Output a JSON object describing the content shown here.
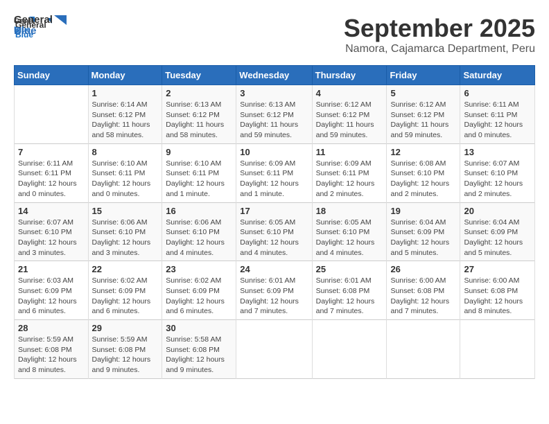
{
  "logo": {
    "general": "General",
    "blue": "Blue"
  },
  "title": "September 2025",
  "subtitle": "Namora, Cajamarca Department, Peru",
  "days_header": [
    "Sunday",
    "Monday",
    "Tuesday",
    "Wednesday",
    "Thursday",
    "Friday",
    "Saturday"
  ],
  "weeks": [
    [
      {
        "day": "",
        "info": ""
      },
      {
        "day": "1",
        "info": "Sunrise: 6:14 AM\nSunset: 6:12 PM\nDaylight: 11 hours\nand 58 minutes."
      },
      {
        "day": "2",
        "info": "Sunrise: 6:13 AM\nSunset: 6:12 PM\nDaylight: 11 hours\nand 58 minutes."
      },
      {
        "day": "3",
        "info": "Sunrise: 6:13 AM\nSunset: 6:12 PM\nDaylight: 11 hours\nand 59 minutes."
      },
      {
        "day": "4",
        "info": "Sunrise: 6:12 AM\nSunset: 6:12 PM\nDaylight: 11 hours\nand 59 minutes."
      },
      {
        "day": "5",
        "info": "Sunrise: 6:12 AM\nSunset: 6:12 PM\nDaylight: 11 hours\nand 59 minutes."
      },
      {
        "day": "6",
        "info": "Sunrise: 6:11 AM\nSunset: 6:11 PM\nDaylight: 12 hours\nand 0 minutes."
      }
    ],
    [
      {
        "day": "7",
        "info": "Sunrise: 6:11 AM\nSunset: 6:11 PM\nDaylight: 12 hours\nand 0 minutes."
      },
      {
        "day": "8",
        "info": "Sunrise: 6:10 AM\nSunset: 6:11 PM\nDaylight: 12 hours\nand 0 minutes."
      },
      {
        "day": "9",
        "info": "Sunrise: 6:10 AM\nSunset: 6:11 PM\nDaylight: 12 hours\nand 1 minute."
      },
      {
        "day": "10",
        "info": "Sunrise: 6:09 AM\nSunset: 6:11 PM\nDaylight: 12 hours\nand 1 minute."
      },
      {
        "day": "11",
        "info": "Sunrise: 6:09 AM\nSunset: 6:11 PM\nDaylight: 12 hours\nand 2 minutes."
      },
      {
        "day": "12",
        "info": "Sunrise: 6:08 AM\nSunset: 6:10 PM\nDaylight: 12 hours\nand 2 minutes."
      },
      {
        "day": "13",
        "info": "Sunrise: 6:07 AM\nSunset: 6:10 PM\nDaylight: 12 hours\nand 2 minutes."
      }
    ],
    [
      {
        "day": "14",
        "info": "Sunrise: 6:07 AM\nSunset: 6:10 PM\nDaylight: 12 hours\nand 3 minutes."
      },
      {
        "day": "15",
        "info": "Sunrise: 6:06 AM\nSunset: 6:10 PM\nDaylight: 12 hours\nand 3 minutes."
      },
      {
        "day": "16",
        "info": "Sunrise: 6:06 AM\nSunset: 6:10 PM\nDaylight: 12 hours\nand 4 minutes."
      },
      {
        "day": "17",
        "info": "Sunrise: 6:05 AM\nSunset: 6:10 PM\nDaylight: 12 hours\nand 4 minutes."
      },
      {
        "day": "18",
        "info": "Sunrise: 6:05 AM\nSunset: 6:10 PM\nDaylight: 12 hours\nand 4 minutes."
      },
      {
        "day": "19",
        "info": "Sunrise: 6:04 AM\nSunset: 6:09 PM\nDaylight: 12 hours\nand 5 minutes."
      },
      {
        "day": "20",
        "info": "Sunrise: 6:04 AM\nSunset: 6:09 PM\nDaylight: 12 hours\nand 5 minutes."
      }
    ],
    [
      {
        "day": "21",
        "info": "Sunrise: 6:03 AM\nSunset: 6:09 PM\nDaylight: 12 hours\nand 6 minutes."
      },
      {
        "day": "22",
        "info": "Sunrise: 6:02 AM\nSunset: 6:09 PM\nDaylight: 12 hours\nand 6 minutes."
      },
      {
        "day": "23",
        "info": "Sunrise: 6:02 AM\nSunset: 6:09 PM\nDaylight: 12 hours\nand 6 minutes."
      },
      {
        "day": "24",
        "info": "Sunrise: 6:01 AM\nSunset: 6:09 PM\nDaylight: 12 hours\nand 7 minutes."
      },
      {
        "day": "25",
        "info": "Sunrise: 6:01 AM\nSunset: 6:08 PM\nDaylight: 12 hours\nand 7 minutes."
      },
      {
        "day": "26",
        "info": "Sunrise: 6:00 AM\nSunset: 6:08 PM\nDaylight: 12 hours\nand 7 minutes."
      },
      {
        "day": "27",
        "info": "Sunrise: 6:00 AM\nSunset: 6:08 PM\nDaylight: 12 hours\nand 8 minutes."
      }
    ],
    [
      {
        "day": "28",
        "info": "Sunrise: 5:59 AM\nSunset: 6:08 PM\nDaylight: 12 hours\nand 8 minutes."
      },
      {
        "day": "29",
        "info": "Sunrise: 5:59 AM\nSunset: 6:08 PM\nDaylight: 12 hours\nand 9 minutes."
      },
      {
        "day": "30",
        "info": "Sunrise: 5:58 AM\nSunset: 6:08 PM\nDaylight: 12 hours\nand 9 minutes."
      },
      {
        "day": "",
        "info": ""
      },
      {
        "day": "",
        "info": ""
      },
      {
        "day": "",
        "info": ""
      },
      {
        "day": "",
        "info": ""
      }
    ]
  ]
}
